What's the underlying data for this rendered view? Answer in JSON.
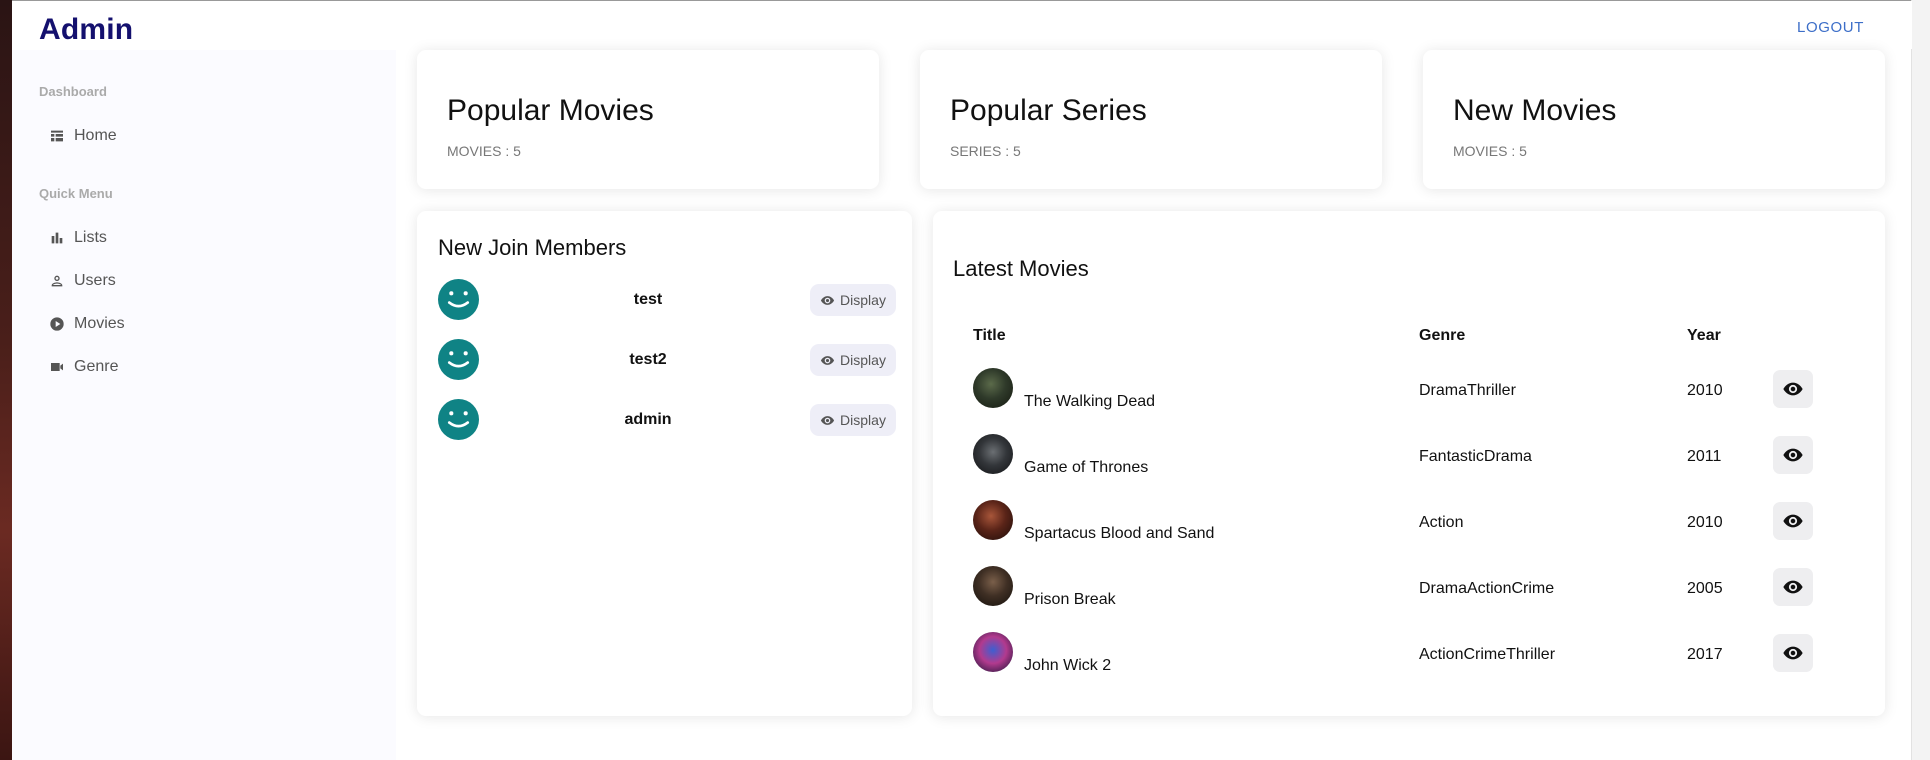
{
  "header": {
    "brand": "Admin",
    "logout_label": "LOGOUT"
  },
  "sidebar": {
    "sections": [
      {
        "title": "Dashboard",
        "items": [
          {
            "label": "Home",
            "icon": "dashboard-icon"
          }
        ]
      },
      {
        "title": "Quick Menu",
        "items": [
          {
            "label": "Lists",
            "icon": "bar-chart-icon"
          },
          {
            "label": "Users",
            "icon": "person-icon"
          },
          {
            "label": "Movies",
            "icon": "play-circle-icon"
          },
          {
            "label": "Genre",
            "icon": "video-camera-icon"
          }
        ]
      }
    ]
  },
  "featured": [
    {
      "title": "Popular Movies",
      "subtitle": "MOVIES : 5"
    },
    {
      "title": "Popular Series",
      "subtitle": "SERIES : 5"
    },
    {
      "title": "New Movies",
      "subtitle": "MOVIES : 5"
    }
  ],
  "members": {
    "title": "New Join Members",
    "button_label": "Display",
    "avatar_icon": "smiley-avatar-icon",
    "avatar_color": "#0f8385",
    "items": [
      {
        "name": "test"
      },
      {
        "name": "test2"
      },
      {
        "name": "admin"
      }
    ]
  },
  "latest": {
    "title": "Latest Movies",
    "columns": [
      "Title",
      "Genre",
      "Year"
    ],
    "view_icon": "eye-icon",
    "rows": [
      {
        "title": "The Walking Dead",
        "genre": "DramaThriller",
        "year": "2010"
      },
      {
        "title": "Game of Thrones",
        "genre": "FantasticDrama",
        "year": "2011"
      },
      {
        "title": "Spartacus Blood and Sand",
        "genre": "Action",
        "year": "2010"
      },
      {
        "title": "Prison Break",
        "genre": "DramaActionCrime",
        "year": "2005"
      },
      {
        "title": "John Wick 2",
        "genre": "ActionCrimeThriller",
        "year": "2017"
      }
    ]
  },
  "colors": {
    "brand": "#14106e",
    "link": "#3c6ec8",
    "sidebar_bg": "#fbfbff"
  }
}
